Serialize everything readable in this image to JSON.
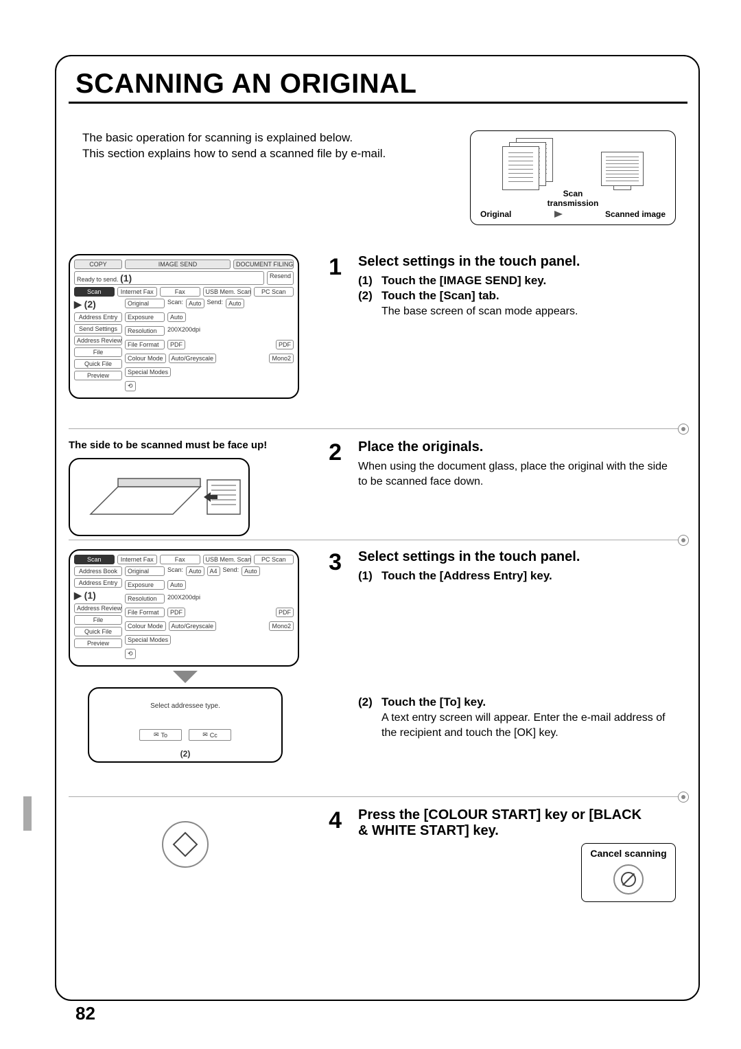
{
  "page": {
    "title": "SCANNING AN ORIGINAL",
    "number": "82",
    "intro_line1": "The basic operation for scanning is explained below.",
    "intro_line2": "This section explains how to send a scanned file by e-mail."
  },
  "diagram": {
    "scan_label_line1": "Scan",
    "scan_label_line2": "transmission",
    "original_label": "Original",
    "scanned_label": "Scanned image"
  },
  "panel_common": {
    "top_tabs": {
      "copy": "COPY",
      "image_send": "IMAGE SEND",
      "doc_filing": "DOCUMENT FILING"
    },
    "ready": "Ready to send.",
    "resend": "Resend",
    "mode_tabs": {
      "scan": "Scan",
      "ifax": "Internet Fax",
      "fax": "Fax",
      "usb": "USB Mem. Scan",
      "pc": "PC Scan"
    },
    "rows": {
      "original": {
        "label": "Original",
        "scan": "Scan:",
        "scan_val": "Auto",
        "send": "Send:",
        "send_val": "Auto",
        "extra": "A4"
      },
      "exposure": {
        "label": "Exposure",
        "val": "Auto"
      },
      "resolution": {
        "label": "Resolution",
        "val": "200X200dpi"
      },
      "fileformat": {
        "label": "File Format",
        "val1": "PDF",
        "val2": "PDF"
      },
      "colourmode": {
        "label": "Colour Mode",
        "val1": "Auto/Greyscale",
        "val2": "Mono2"
      },
      "special": {
        "label": "Special Modes"
      }
    },
    "side": {
      "address_book": "Address Book",
      "address_entry": "Address Entry",
      "send_settings": "Send Settings",
      "address_review": "Address Review",
      "file": "File",
      "quick_file": "Quick File",
      "preview": "Preview"
    }
  },
  "step1": {
    "num": "1",
    "title": "Select settings in the touch panel.",
    "sub1_num": "(1)",
    "sub1": "Touch the [IMAGE SEND] key.",
    "sub2_num": "(2)",
    "sub2": "Touch the [Scan] tab.",
    "detail": "The base screen of scan mode appears.",
    "callout1": "(1)",
    "callout2": "(2)"
  },
  "step2": {
    "num": "2",
    "title": "Place the originals.",
    "detail": "When using the document glass, place the original with the side to be scanned face down.",
    "note": "The side to be scanned must be face up!"
  },
  "step3": {
    "num": "3",
    "title": "Select settings in the touch panel.",
    "sub1_num": "(1)",
    "sub1": "Touch the [Address Entry] key.",
    "sub2_num": "(2)",
    "sub2": "Touch the [To] key.",
    "detail2": "A text entry screen will appear. Enter the e-mail address of the recipient and touch the [OK] key.",
    "dialog_text": "Select addressee type.",
    "dialog_to": "To",
    "dialog_cc": "Cc",
    "callout1": "(1)",
    "callout2": "(2)"
  },
  "step4": {
    "num": "4",
    "title": "Press the [COLOUR START] key or [BLACK & WHITE START] key.",
    "cancel_label": "Cancel scanning"
  }
}
